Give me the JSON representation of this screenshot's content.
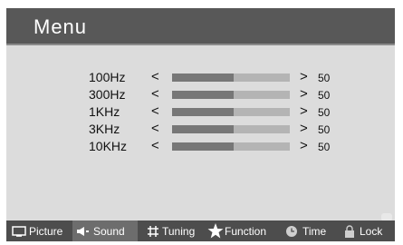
{
  "window": {
    "title": "Menu"
  },
  "equalizer": {
    "bands": [
      {
        "label": "100Hz",
        "left_symbol": "<",
        "right_symbol": ">",
        "value": "50",
        "level": 0.52
      },
      {
        "label": "300Hz",
        "left_symbol": "<",
        "right_symbol": ">",
        "value": "50",
        "level": 0.52
      },
      {
        "label": "1KHz",
        "left_symbol": "<",
        "right_symbol": ">",
        "value": "50",
        "level": 0.52
      },
      {
        "label": "3KHz",
        "left_symbol": "<",
        "right_symbol": ">",
        "value": "50",
        "level": 0.52
      },
      {
        "label": "10KHz",
        "left_symbol": "<",
        "right_symbol": ">",
        "value": "50",
        "level": 0.52
      }
    ]
  },
  "footer": {
    "tabs": [
      {
        "label": "Picture",
        "icon": "tv-icon",
        "active": false
      },
      {
        "label": "Sound",
        "icon": "speaker-icon",
        "active": true
      },
      {
        "label": "Tuning",
        "icon": "hash-icon",
        "active": false
      },
      {
        "label": "Function",
        "icon": "star-icon",
        "active": false
      },
      {
        "label": "Time",
        "icon": "clock-icon",
        "active": false
      },
      {
        "label": "Lock",
        "icon": "lock-icon",
        "active": false
      }
    ]
  },
  "colors": {
    "title_bar": "#585858",
    "panel": "#dcdcdc",
    "footer": "#4d4d4d",
    "active_tab": "#6d6d6d"
  }
}
